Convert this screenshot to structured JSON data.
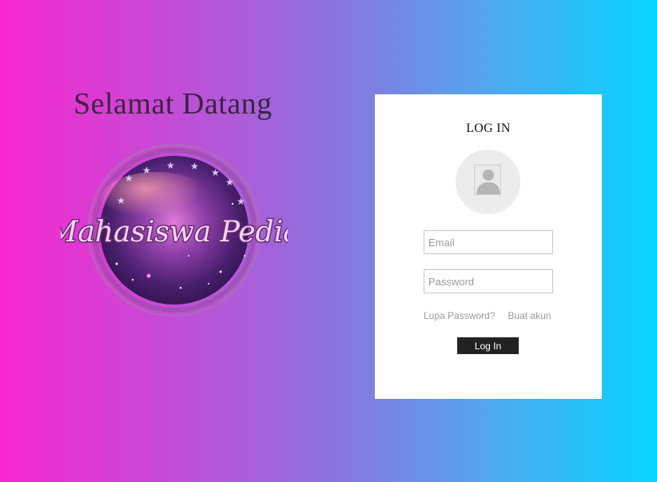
{
  "welcome": {
    "title": "Selamat Datang"
  },
  "logo": {
    "text": "Mahasiswa Pedia"
  },
  "login": {
    "title": "LOG IN",
    "email": {
      "placeholder": "Email",
      "value": ""
    },
    "password": {
      "placeholder": "Password",
      "value": ""
    },
    "forgot_label": "Lupa Password?",
    "signup_label": "Buat akun",
    "submit_label": "Log In"
  },
  "colors": {
    "gradient_start": "#f927cf",
    "gradient_end": "#05d4ff",
    "card_background": "#ffffff",
    "button_background": "#222222",
    "title_color": "#3b2540"
  },
  "icons": {
    "avatar": "user-placeholder-icon"
  }
}
